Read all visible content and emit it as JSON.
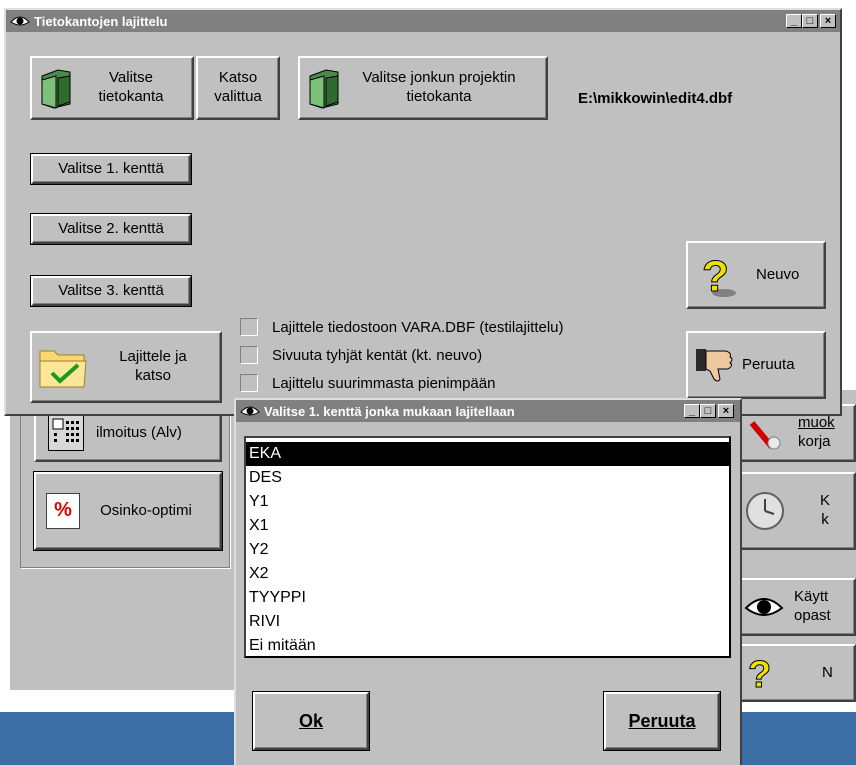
{
  "main_window": {
    "title": "Tietokantojen lajittelu",
    "minimize": "_",
    "maximize": "□",
    "close": "×",
    "choose_db_label": "Valitse tietokanta",
    "view_selected_label": "Katso valittua",
    "choose_project_db_label": "Valitse jonkun projektin tietokanta",
    "current_path": "E:\\mikkowin\\edit4.dbf",
    "field1_label": "Valitse 1. kenttä",
    "field2_label": "Valitse 2. kenttä",
    "field3_label": "Valitse 3. kenttä",
    "sort_view_label": "Lajittele ja katso",
    "help_label": "Neuvo",
    "cancel_label": "Peruuta",
    "options": [
      "Lajittele tiedostoon VARA.DBF (testilajittelu)",
      "Sivuuta tyhjät kentät (kt. neuvo)",
      "Lajittelu suurimmasta pienimpään"
    ]
  },
  "background_app": {
    "btn_alv_label": "ilmoitus (Alv)",
    "btn_osinko_label": "Osinko-optimi",
    "btn_edit_line1": "muok",
    "btn_edit_line2": "korja",
    "btn_clock_line1": "K",
    "btn_clock_line2": "k",
    "btn_guide_line1": "Käytt",
    "btn_guide_line2": "opast",
    "btn_help_partial": "N"
  },
  "dialog": {
    "title": "Valitse 1. kenttä jonka mukaan lajitellaan",
    "items": [
      "EKA",
      "DES",
      "Y1",
      "X1",
      "Y2",
      "X2",
      "TYYPPI",
      "RIVI",
      "Ei mitään"
    ],
    "selected_index": 0,
    "ok_label": "Ok",
    "cancel_label": "Peruuta"
  },
  "colors": {
    "face": "#c0c0c0",
    "titlebar": "#808080",
    "desktop": "#3a6ea5",
    "selection": "#000000"
  }
}
